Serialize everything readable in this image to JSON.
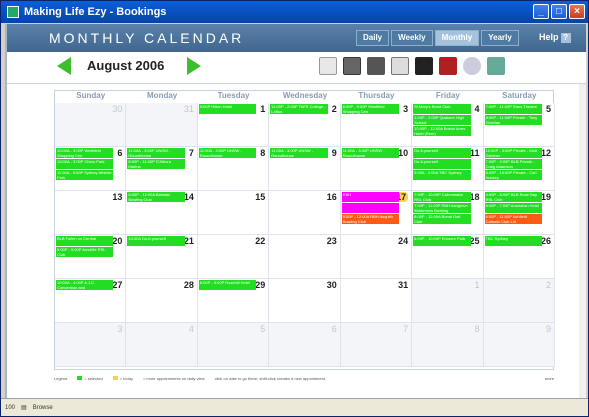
{
  "window": {
    "title": "Making Life Ezy - Bookings"
  },
  "header": {
    "title": "MONTHLY CALENDAR",
    "views": [
      {
        "label": "Daily",
        "active": false
      },
      {
        "label": "Weekly",
        "active": false
      },
      {
        "label": "Monthly",
        "active": true
      },
      {
        "label": "Yearly",
        "active": false
      }
    ],
    "help": "Help",
    "help_icon": "?"
  },
  "nav": {
    "month": "August 2006"
  },
  "toolbar_icons": [
    "calendar-icon",
    "print-icon",
    "save-icon",
    "help-icon",
    "binoculars-icon",
    "binoculars-red-icon",
    "magnifier-icon",
    "users-icon"
  ],
  "days_of_week": [
    "Sunday",
    "Monday",
    "Tuesday",
    "Wednesday",
    "Thursday",
    "Friday",
    "Saturday"
  ],
  "weeks": [
    [
      {
        "day": "30",
        "other": true,
        "events": []
      },
      {
        "day": "31",
        "other": true,
        "events": []
      },
      {
        "day": "1",
        "events": [
          {
            "text": "9:00P Hilton Hotel",
            "color": "green"
          }
        ]
      },
      {
        "day": "2",
        "events": [
          {
            "text": "11:00P - 2:00P TAFE College - Loftus",
            "color": "green"
          }
        ]
      },
      {
        "day": "3",
        "events": [
          {
            "text": "6:00P - 9:00P Westfield Shopping Cen",
            "color": "green"
          }
        ]
      },
      {
        "day": "4",
        "events": [
          {
            "text": "St Mary's Band Club",
            "color": "green"
          },
          {
            "text": "1:00P - 2:00P Quakers High School",
            "color": "green"
          },
          {
            "text": "10:00P - 12:00A Bristol Arms Hotel (Rem)",
            "color": "green"
          }
        ]
      },
      {
        "day": "5",
        "events": [
          {
            "text": "7:00P - 11:00P Stars Theatre",
            "color": "green"
          },
          {
            "text": "8:00P - 11:00P Private - Tony Ginellas",
            "color": "green"
          }
        ]
      }
    ],
    [
      {
        "day": "6",
        "events": [
          {
            "text": "10:00A - 3:00P Westfield Shopping Cen",
            "color": "green"
          },
          {
            "text": "10:00A - 3:00P Civics Park",
            "color": "green"
          },
          {
            "text": "11:00A - 5:00P Sydney Athletic Park",
            "color": "green"
          }
        ]
      },
      {
        "day": "7",
        "events": [
          {
            "text": "11:00A - 3:00P UNSW - Roundhouse",
            "color": "green"
          },
          {
            "text": "8:00P - 11:30P D'Albora Marina",
            "color": "green"
          }
        ]
      },
      {
        "day": "8",
        "events": [
          {
            "text": "11:00A - 3:00P UNSW - Roundhouse",
            "color": "green"
          }
        ]
      },
      {
        "day": "9",
        "events": [
          {
            "text": "11:00A - 3:00P UNSW - Roundhouse",
            "color": "green"
          }
        ]
      },
      {
        "day": "10",
        "events": [
          {
            "text": "11:00A - 3:00P UNSW - Roundhouse",
            "color": "green"
          }
        ]
      },
      {
        "day": "11",
        "events": [
          {
            "text": "Do-it-yourself",
            "color": "green"
          },
          {
            "text": "Do-it-yourself",
            "color": "green"
          },
          {
            "text": "9:00A - 2:00A TBC Sydney",
            "color": "green"
          }
        ]
      },
      {
        "day": "12",
        "events": [
          {
            "text": "12:00P - 5:00P Private - Matt Gardner",
            "color": "green"
          },
          {
            "text": "7:00P - 9:00P BLB Private - Craig Adamson",
            "color": "green"
          },
          {
            "text": "8:00P - 10:00P Private - Carl Hockey",
            "color": "green"
          }
        ]
      }
    ],
    [
      {
        "day": "13",
        "events": []
      },
      {
        "day": "14",
        "events": [
          {
            "text": "8:00P - 12:00A Balmain Bowling Club",
            "color": "green"
          }
        ]
      },
      {
        "day": "15",
        "events": []
      },
      {
        "day": "16",
        "events": []
      },
      {
        "day": "17",
        "today": true,
        "events": [
          {
            "text": "RBH",
            "color": "pink"
          },
          {
            "text": "",
            "color": "pink"
          },
          {
            "text": "8:00P - 12:00A RBH Asquith Bowling Club",
            "color": "orange"
          }
        ]
      },
      {
        "day": "18",
        "events": [
          {
            "text": "7:00P - 10:00P Cabramatta RSL Club",
            "color": "green"
          },
          {
            "text": "7:00P - 11:00P RBH Ashgrove Workmens Bowling",
            "color": "green"
          },
          {
            "text": "8:00P - 12:00A Bondi Golf Club",
            "color": "green"
          }
        ]
      },
      {
        "day": "19",
        "events": [
          {
            "text": "4:00P - 8:00P BLB Rose Bay RSL Club",
            "color": "green"
          },
          {
            "text": "5:00P - 7:00P Australian Hotel",
            "color": "green"
          },
          {
            "text": "6:00P - 11:00P Ashfield Catholic Club Ltd",
            "color": "orange"
          }
        ]
      }
    ],
    [
      {
        "day": "20",
        "events": [
          {
            "text": "BLB Fallen on Central",
            "color": "green"
          },
          {
            "text": "5:00P - 9:00P Arncliffe RSL Club",
            "color": "green"
          }
        ]
      },
      {
        "day": "21",
        "events": [
          {
            "text": "10:00A Do-it-yourself",
            "color": "green"
          }
        ]
      },
      {
        "day": "22",
        "events": []
      },
      {
        "day": "23",
        "events": []
      },
      {
        "day": "24",
        "events": []
      },
      {
        "day": "25",
        "events": [
          {
            "text": "6:00P - 10:00P Enmore Park",
            "color": "green"
          }
        ]
      },
      {
        "day": "26",
        "events": [
          {
            "text": "TBC Sydney",
            "color": "green"
          }
        ]
      }
    ],
    [
      {
        "day": "27",
        "events": [
          {
            "text": "10:00A - 4:00P A.J.C. Convention and",
            "color": "green"
          }
        ]
      },
      {
        "day": "28",
        "events": []
      },
      {
        "day": "29",
        "events": [
          {
            "text": "6:00P - 9:00P Rosehill Hotel",
            "color": "green"
          }
        ]
      },
      {
        "day": "30",
        "events": []
      },
      {
        "day": "31",
        "events": []
      },
      {
        "day": "1",
        "other": true,
        "events": []
      },
      {
        "day": "2",
        "other": true,
        "events": []
      }
    ],
    [
      {
        "day": "3",
        "other": true,
        "events": []
      },
      {
        "day": "4",
        "other": true,
        "events": []
      },
      {
        "day": "5",
        "other": true,
        "events": []
      },
      {
        "day": "6",
        "other": true,
        "events": []
      },
      {
        "day": "7",
        "other": true,
        "events": []
      },
      {
        "day": "8",
        "other": true,
        "events": []
      },
      {
        "day": "9",
        "other": true,
        "events": []
      }
    ]
  ],
  "legend": {
    "label": "Legend",
    "selected": "= selected",
    "today": "= today",
    "more": "= more appointments on daily view",
    "hint": "click on date to go there; shift-click creates a new appointment.",
    "more_link": "more"
  },
  "colors": {
    "green": "#22dd22",
    "pink": "#ff00ff",
    "orange": "#ff5a14",
    "header": "#4f78a0"
  },
  "statusbar": {
    "zoom": "100",
    "mode": "Browse"
  }
}
